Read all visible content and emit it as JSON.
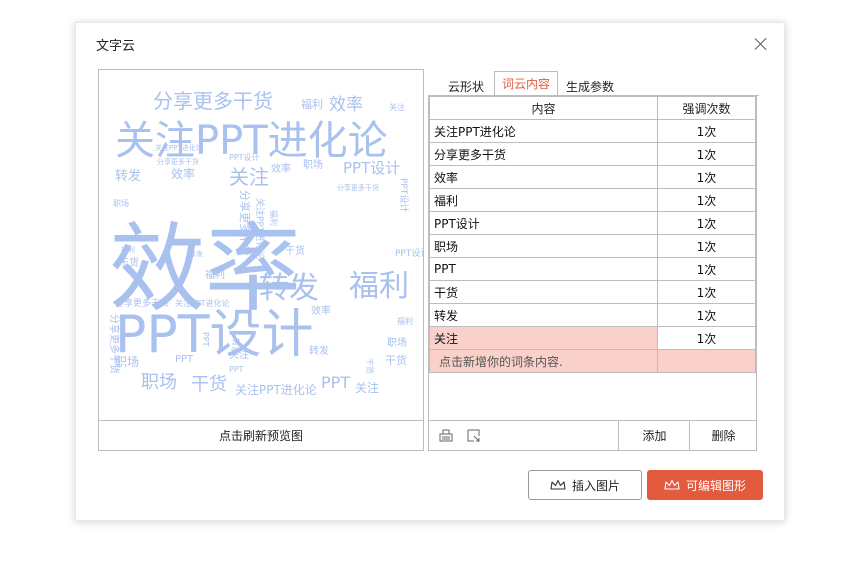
{
  "dialog": {
    "title": "文字云",
    "refresh_label": "点击刷新预览图",
    "tabs": [
      {
        "label": "云形状",
        "active": false
      },
      {
        "label": "词云内容",
        "active": true
      },
      {
        "label": "生成参数",
        "active": false
      }
    ],
    "table": {
      "headers": [
        "内容",
        "强调次数"
      ],
      "rows": [
        {
          "word": "关注PPT进化论",
          "count": "1次"
        },
        {
          "word": "分享更多干货",
          "count": "1次"
        },
        {
          "word": "效率",
          "count": "1次"
        },
        {
          "word": "福利",
          "count": "1次"
        },
        {
          "word": "PPT设计",
          "count": "1次"
        },
        {
          "word": "职场",
          "count": "1次"
        },
        {
          "word": "PPT",
          "count": "1次"
        },
        {
          "word": "干货",
          "count": "1次"
        },
        {
          "word": "转发",
          "count": "1次"
        },
        {
          "word": "关注",
          "count": "1次"
        }
      ],
      "add_placeholder": "点击新增你的词条内容."
    },
    "buttons": {
      "add": "添加",
      "delete": "删除",
      "insert_image": "插入图片",
      "editable_shape": "可编辑图形"
    },
    "colors": {
      "cloud": "#a9c1ee",
      "accent": "#e35b3f",
      "selected_row": "#f9d0ca"
    }
  }
}
